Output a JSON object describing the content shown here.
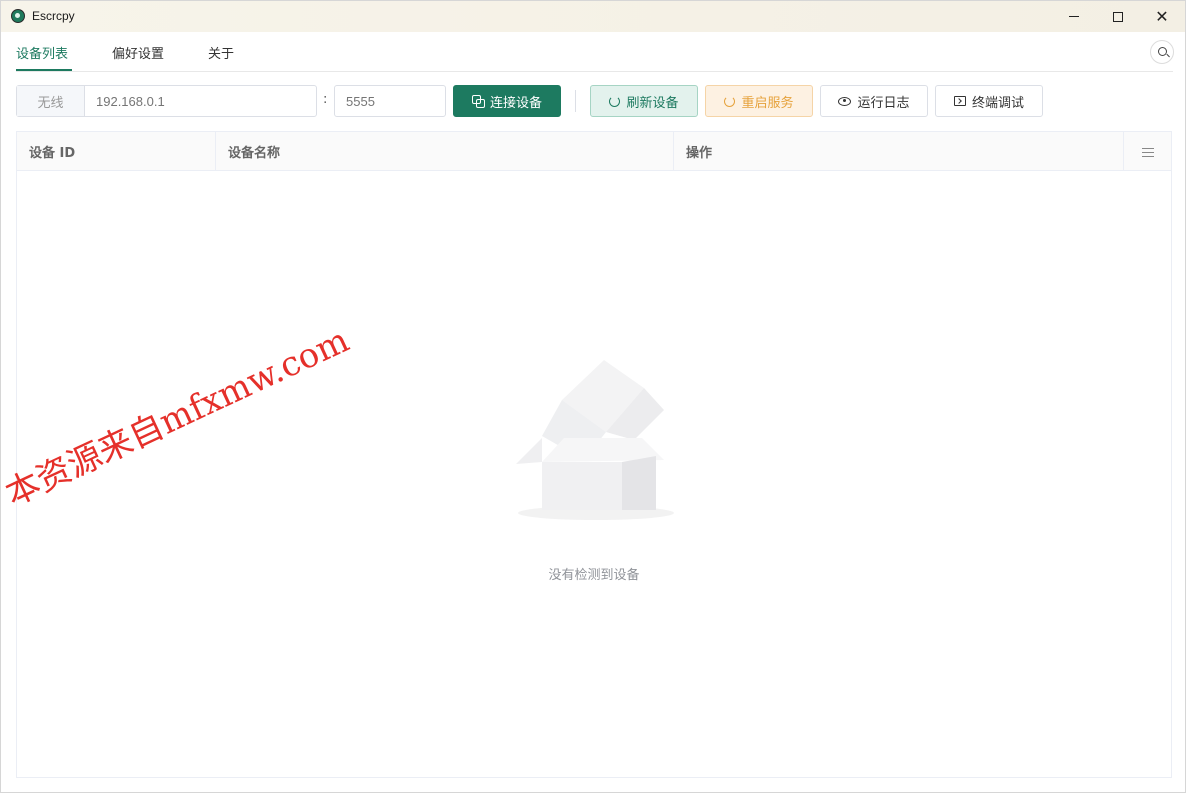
{
  "window": {
    "title": "Escrcpy",
    "minimize_icon": "minimize-icon",
    "maximize_icon": "maximize-icon",
    "close_icon": "close-icon"
  },
  "tabs": [
    {
      "label": "设备列表",
      "active": true
    },
    {
      "label": "偏好设置",
      "active": false
    },
    {
      "label": "关于",
      "active": false
    }
  ],
  "toolbar": {
    "address_prefix": "无线",
    "address_placeholder": "192.168.0.1",
    "colon": ":",
    "port_placeholder": "5555",
    "connect_label": "连接设备",
    "refresh_label": "刷新设备",
    "restart_label": "重启服务",
    "log_label": "运行日志",
    "terminal_label": "终端调试"
  },
  "table": {
    "columns": [
      "设备 ID",
      "设备名称",
      "操作"
    ],
    "empty_text": "没有检测到设备"
  },
  "watermark": "本资源来自mfxmw.com",
  "colors": {
    "primary": "#1d7a60",
    "warning": "#e6a23c",
    "watermark": "#e5302a"
  }
}
